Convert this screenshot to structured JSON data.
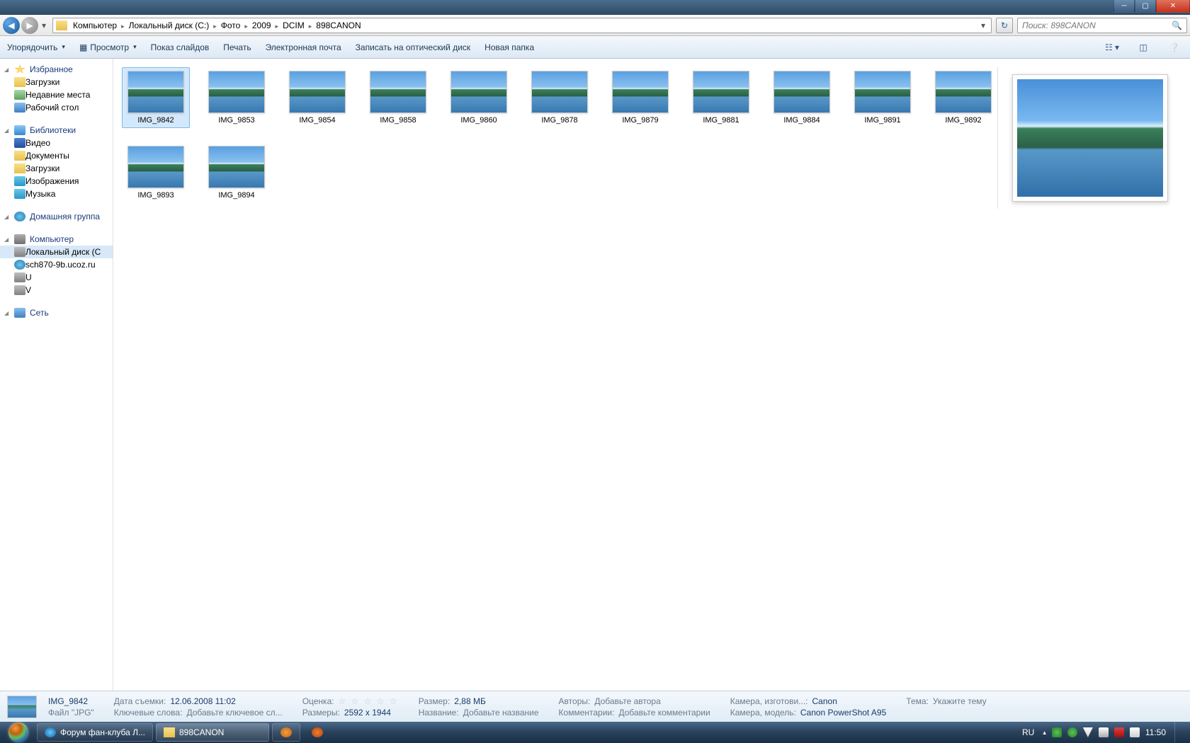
{
  "breadcrumbs": [
    "Компьютер",
    "Локальный диск (C:)",
    "Фото",
    "2009",
    "DCIM",
    "898CANON"
  ],
  "search_placeholder": "Поиск: 898CANON",
  "toolbar": {
    "organize": "Упорядочить",
    "view": "Просмотр",
    "slideshow": "Показ слайдов",
    "print": "Печать",
    "email": "Электронная почта",
    "burn": "Записать на оптический диск",
    "newfolder": "Новая папка"
  },
  "sidebar": {
    "favorites": {
      "head": "Избранное",
      "items": [
        "Загрузки",
        "Недавние места",
        "Рабочий стол"
      ]
    },
    "libraries": {
      "head": "Библиотеки",
      "items": [
        "Видео",
        "Документы",
        "Загрузки",
        "Изображения",
        "Музыка"
      ]
    },
    "homegroup": {
      "head": "Домашняя группа"
    },
    "computer": {
      "head": "Компьютер",
      "items": [
        "Локальный диск (C",
        "sch870-9b.ucoz.ru",
        "U",
        "V"
      ]
    },
    "network": {
      "head": "Сеть"
    }
  },
  "files": [
    "IMG_9842",
    "IMG_9853",
    "IMG_9854",
    "IMG_9858",
    "IMG_9860",
    "IMG_9878",
    "IMG_9879",
    "IMG_9881",
    "IMG_9884",
    "IMG_9891",
    "IMG_9892",
    "IMG_9893",
    "IMG_9894"
  ],
  "selected_file": "IMG_9842",
  "details": {
    "name": "IMG_9842",
    "type_label": "Файл \"JPG\"",
    "date_label": "Дата съемки:",
    "date": "12.06.2008 11:02",
    "keywords_label": "Ключевые слова:",
    "keywords": "Добавьте ключевое сл...",
    "rating_label": "Оценка:",
    "dim_label": "Размеры:",
    "dim": "2592 x 1944",
    "size_label": "Размер:",
    "size": "2,88 МБ",
    "title_label": "Название:",
    "title": "Добавьте название",
    "authors_label": "Авторы:",
    "authors": "Добавьте автора",
    "comments_label": "Комментарии:",
    "comments": "Добавьте комментарии",
    "cam_make_label": "Камера, изготови...:",
    "cam_make": "Canon",
    "cam_model_label": "Камера, модель:",
    "cam_model": "Canon PowerShot A95",
    "theme_label": "Тема:",
    "theme": "Укажите тему"
  },
  "taskbar": {
    "tasks": [
      "Форум фан-клуба Л...",
      "898CANON"
    ],
    "lang": "RU",
    "clock": "11:50"
  }
}
